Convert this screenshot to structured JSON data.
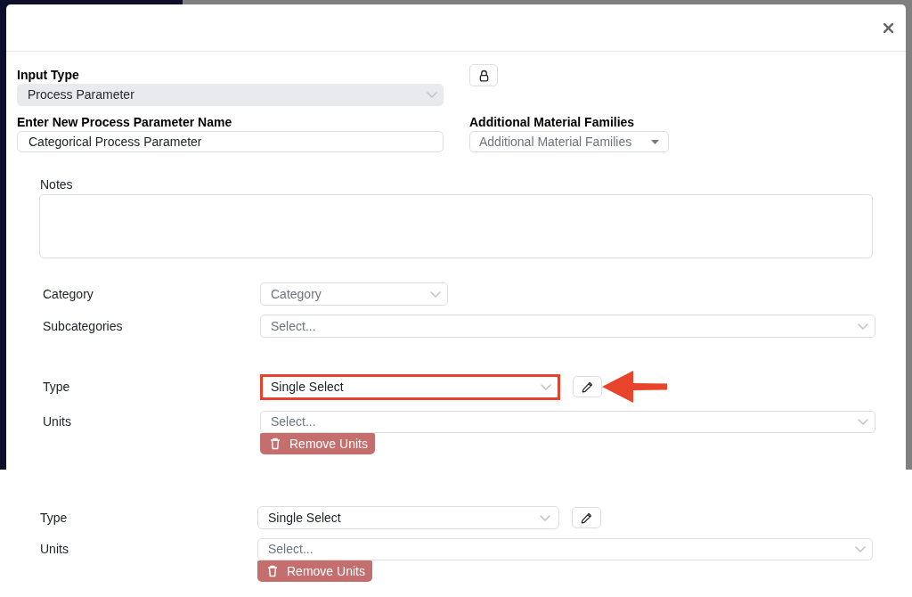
{
  "input_type": {
    "label": "Input Type",
    "value": "Process Parameter",
    "disabled": true
  },
  "parameter_name": {
    "label": "Enter New Process Parameter Name",
    "value": "Categorical Process Parameter"
  },
  "additional_material_families": {
    "label": "Additional Material Families",
    "placeholder": "Additional Material Families"
  },
  "notes": {
    "label": "Notes"
  },
  "category": {
    "label": "Category",
    "placeholder": "Category"
  },
  "subcategories": {
    "label": "Subcategories",
    "placeholder": "Select..."
  },
  "unit_groups": [
    {
      "type": {
        "label": "Type",
        "value": "Single Select",
        "highlighted": true,
        "annotation_arrow": true
      },
      "units": {
        "label": "Units",
        "placeholder": "Select..."
      },
      "remove_button": "Remove Units"
    },
    {
      "type": {
        "label": "Type",
        "value": "Single Select",
        "highlighted": false,
        "annotation_arrow": false
      },
      "units": {
        "label": "Units",
        "placeholder": "Select..."
      },
      "remove_button": "Remove Units"
    }
  ]
}
